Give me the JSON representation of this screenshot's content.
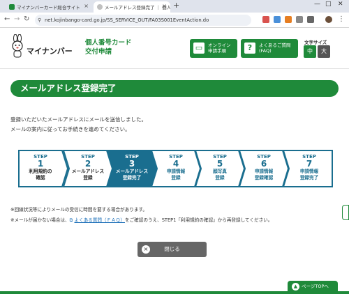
{
  "browser": {
    "tabs": [
      {
        "title": "マイナンバーカード総合サイト"
      },
      {
        "title": "メールアドレス登録完了 ｜ 個人番号"
      }
    ],
    "new_tab": "+",
    "url": "net.kojinbango-card.go.jp/SS_SERVICE_OUT/FA03S001EventAction.do",
    "window_controls": {
      "minimize": "—",
      "maximize": "□",
      "close": "✕"
    }
  },
  "header": {
    "logo_text": "マイナンバー",
    "site_title_line1": "個人番号カード",
    "site_title_line2": "交付申請",
    "online_btn_line1": "オンライン",
    "online_btn_line2": "申請手順",
    "faq_btn_line1": "よくあるご質問",
    "faq_btn_line2": "(FAQ)",
    "font_size_label": "文字サイズ",
    "font_medium": "中",
    "font_large": "大"
  },
  "main": {
    "page_title": "メールアドレス登録完了",
    "message_line1": "登録いただいたメールアドレスにメールを送信しました。",
    "message_line2": "メールの案内に従ってお手続きを進めてください。",
    "steps": [
      {
        "label": "STEP",
        "number": "1",
        "name1": "利用規約の",
        "name2": "確認"
      },
      {
        "label": "STEP",
        "number": "2",
        "name1": "メールアドレス",
        "name2": "登録"
      },
      {
        "label": "STEP",
        "number": "3",
        "name1": "メールアドレス",
        "name2": "登録完了"
      },
      {
        "label": "STEP",
        "number": "4",
        "name1": "申請情報",
        "name2": "登録"
      },
      {
        "label": "STEP",
        "number": "5",
        "name1": "顔写真",
        "name2": "登録"
      },
      {
        "label": "STEP",
        "number": "6",
        "name1": "申請情報",
        "name2": "登録確認"
      },
      {
        "label": "STEP",
        "number": "7",
        "name1": "申請情報",
        "name2": "登録完了"
      }
    ],
    "note1": "※回線状況等によりメールの受信に時間を要する場合があります。",
    "note2_prefix": "※メールが届かない場合は、",
    "note2_link": "よくある質問（ＦＡＱ）",
    "note2_suffix": "をご確認のうえ、STEP1「利用規約の確認」から再登録してください。",
    "close_button": "閉じる"
  },
  "footer": {
    "page_top": "ページTOPへ"
  },
  "colors": {
    "brand_green": "#1f8a3a",
    "step_teal": "#1a6e8f",
    "step_active": "#1a6e8f"
  }
}
